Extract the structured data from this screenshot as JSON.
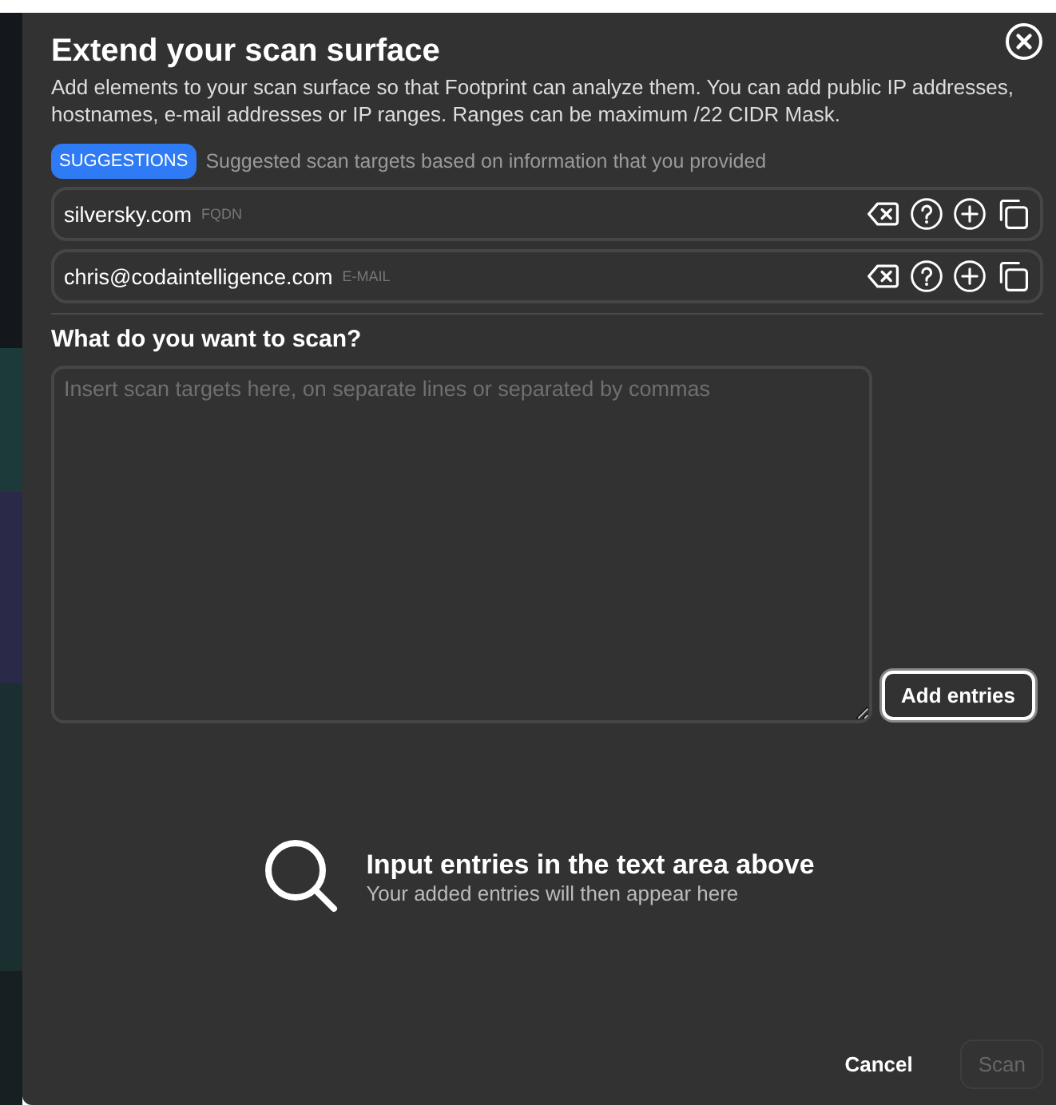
{
  "dialog": {
    "title": "Extend your scan surface",
    "description": "Add elements to your scan surface so that Footprint can analyze them. You can add public IP addresses, hostnames, e-mail addresses or IP ranges. Ranges can be maximum /22 CIDR Mask."
  },
  "suggestions": {
    "badge": "SUGGESTIONS",
    "hint": "Suggested scan targets based on information that you provided",
    "items": [
      {
        "value": "silversky.com",
        "type": "FQDN"
      },
      {
        "value": "chris@codaintelligence.com",
        "type": "E-MAIL"
      }
    ]
  },
  "scan_input": {
    "label": "What do you want to scan?",
    "placeholder": "Insert scan targets here, on separate lines or separated by commas",
    "add_button": "Add entries"
  },
  "empty_state": {
    "title": "Input entries in the text area above",
    "subtitle": "Your added entries will then appear here"
  },
  "buttons": [
    {
      "label": "Cancel",
      "kind": "text",
      "disabled": false
    },
    {
      "label": "Scan",
      "kind": "primary",
      "disabled": true
    }
  ]
}
